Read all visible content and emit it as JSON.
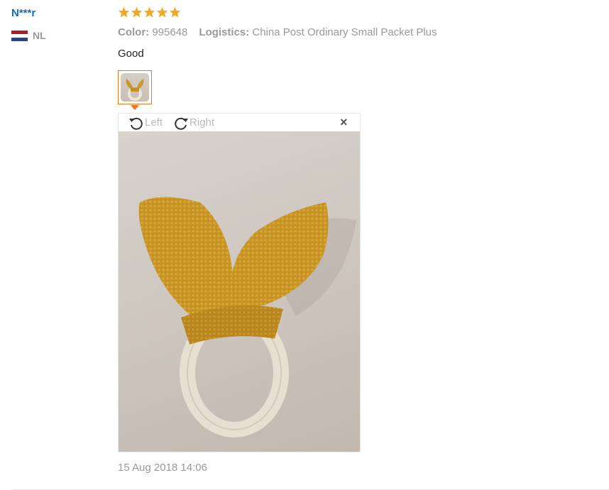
{
  "review": {
    "user_name": "N***r",
    "country": "NL",
    "rating": 5,
    "color_label": "Color:",
    "color_value": "995648",
    "logistics_label": "Logistics:",
    "logistics_value": "China Post Ordinary Small Packet Plus",
    "text": "Good",
    "date": "15 Aug 2018 14:06"
  },
  "viewer": {
    "rotate_left_label": "Left",
    "rotate_right_label": "Right",
    "close_label": "×"
  },
  "colors": {
    "user_link": "#0b6fc7",
    "star": "#f5a623",
    "accent": "#e8791e",
    "flag_red": "#ae1c28",
    "flag_white": "#ffffff",
    "flag_blue": "#21468b"
  },
  "icons": [
    "star-icon",
    "netherlands-flag-icon",
    "rotate-left-icon",
    "rotate-right-icon",
    "close-icon"
  ]
}
